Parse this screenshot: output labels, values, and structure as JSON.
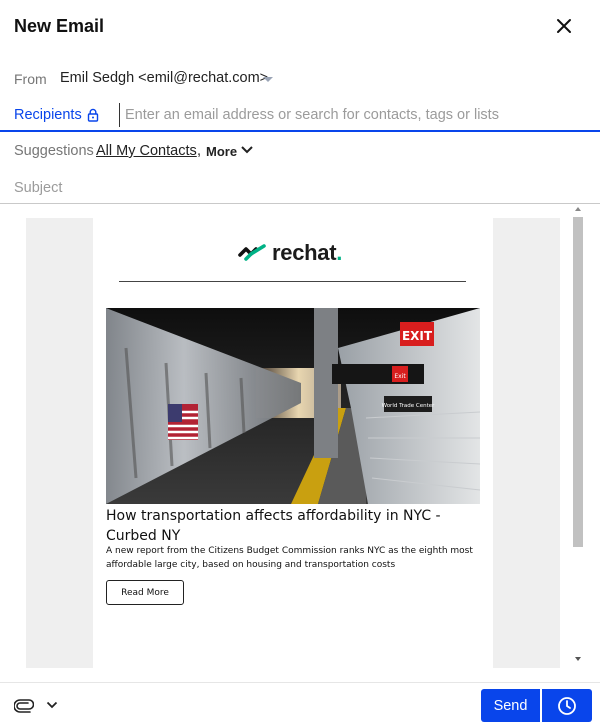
{
  "header": {
    "title": "New Email",
    "close_icon": "close-icon"
  },
  "from": {
    "label": "From",
    "value": "Emil Sedgh <emil@rechat.com>"
  },
  "recipients": {
    "label": "Recipients",
    "placeholder": "Enter an email address or search for contacts, tags or lists",
    "icon": "lock-icon"
  },
  "suggestions": {
    "label": "Suggestions",
    "link": "All My Contacts",
    "separator": ",",
    "more_label": "More"
  },
  "subject": {
    "placeholder": "Subject"
  },
  "email_body": {
    "logo_text": "rechat",
    "logo_dot": ".",
    "article_title": "How transportation affects affordability in NYC - Curbed NY",
    "article_description": "A new report from the Citizens Budget Commission ranks NYC as the eighth most affordable large city, based on housing and transportation costs",
    "read_more_label": "Read More",
    "photo_signs": {
      "exit_top": "EXIT",
      "exit_small": "Exit",
      "station": "World Trade Center"
    }
  },
  "footer": {
    "send_label": "Send",
    "attach_icon": "paperclip-icon",
    "schedule_icon": "clock-icon"
  },
  "colors": {
    "accent": "#0945eb",
    "brand_green": "#00b286",
    "muted_text": "#767676",
    "placeholder": "#9b9b9b"
  }
}
